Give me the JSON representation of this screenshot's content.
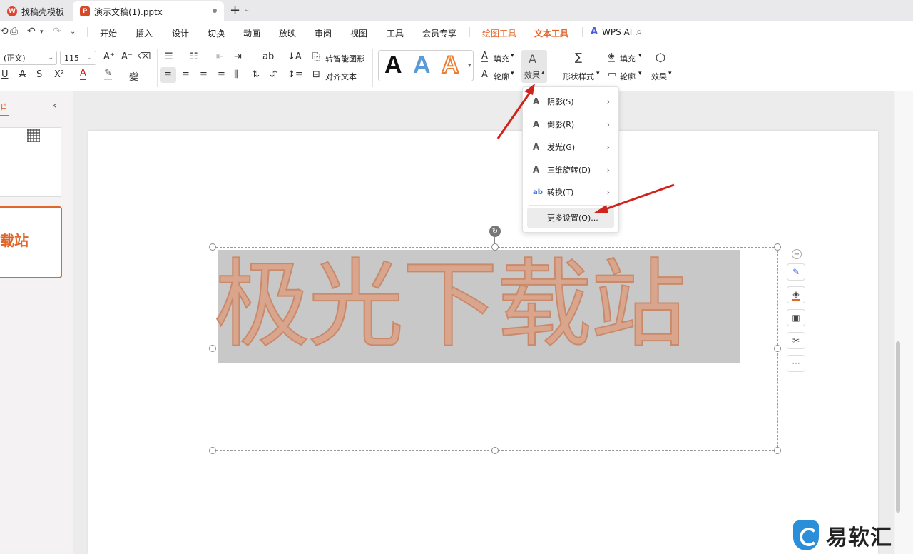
{
  "tabs": [
    {
      "label": "找稿壳模板",
      "icon": "wps-logo-icon"
    },
    {
      "label": "演示文稿(1).pptx",
      "icon": "ppt-file-icon"
    }
  ],
  "menu": [
    "开始",
    "插入",
    "设计",
    "切换",
    "动画",
    "放映",
    "审阅",
    "视图",
    "工具",
    "会员专享",
    "绘图工具",
    "文本工具",
    "WPS AI"
  ],
  "ribbon": {
    "font_name": "(正文)",
    "font_size": "115",
    "smart_shape": "转智能图形",
    "align_text": "对齐文本",
    "fill": "填充",
    "outline": "轮廓",
    "effect": "效果",
    "shape_style": "形状样式",
    "shape_fill": "填充",
    "shape_outline": "轮廓",
    "shape_effect": "效果"
  },
  "left_panel": {
    "title": "片",
    "thumb2_text": "载站"
  },
  "slide_text": "极光下载站",
  "dropdown": {
    "items": [
      {
        "label": "阴影(S)"
      },
      {
        "label": "倒影(R)"
      },
      {
        "label": "发光(G)"
      },
      {
        "label": "三维旋转(D)"
      },
      {
        "label": "转换(T)"
      }
    ],
    "more": "更多设置(O)..."
  },
  "watermark": "易软汇",
  "colors": {
    "accent": "#e0662a",
    "arrow": "#d0231c",
    "text_fill": "#d9a58d"
  }
}
